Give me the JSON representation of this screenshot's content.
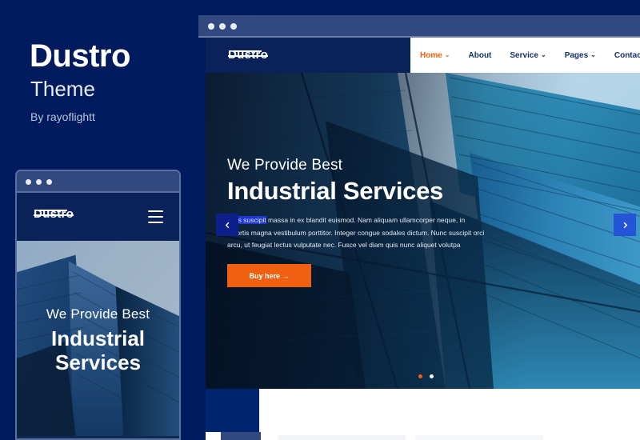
{
  "promo": {
    "title": "Dustro",
    "subtitle": "Theme",
    "author": "By rayoflightt"
  },
  "colors": {
    "background_navy": "#001a5e",
    "titlebar_blue": "#31497e",
    "brand_navy": "#0a2259",
    "accent_orange": "#ef6010",
    "nav_text": "#14306b",
    "arrow_prev": "#0c1f8a",
    "arrow_next": "#2455d8",
    "selection_blue": "#1d36d6"
  },
  "mobile_preview": {
    "titlebar_dots": 3,
    "logo": "Dustro",
    "menu_icon": "hamburger-icon",
    "hero": {
      "lead": "We Provide Best",
      "title_line1": "Industrial",
      "title_line2": "Services"
    }
  },
  "desktop_preview": {
    "titlebar_dots": 3,
    "logo": "Dustro",
    "nav": [
      {
        "label": "Home",
        "active": true,
        "has_dropdown": true
      },
      {
        "label": "About",
        "active": false,
        "has_dropdown": false
      },
      {
        "label": "Service",
        "active": false,
        "has_dropdown": true
      },
      {
        "label": "Pages",
        "active": false,
        "has_dropdown": true
      },
      {
        "label": "Contact",
        "active": false,
        "has_dropdown": true
      }
    ],
    "hero": {
      "lead": "We Provide Best",
      "title": "Industrial Services",
      "paragraph_selected": "Cras suscipit",
      "paragraph_rest": " massa in ex blandit euismod. Nam aliquam ullamcorper neque, in lobortis magna vestibulum porttitor. Integer congue sodales dictum. Nunc suscipit orci arcu, ut feugiat lectus vulputate nec. Fusce vel diam quis nunc aliquet volutpa",
      "cta_label": "Buy here →",
      "prev_icon": "chevron-left-icon",
      "next_icon": "chevron-right-icon",
      "slide_count": 2,
      "active_slide": 1
    }
  },
  "caret_glyph": "⌄"
}
